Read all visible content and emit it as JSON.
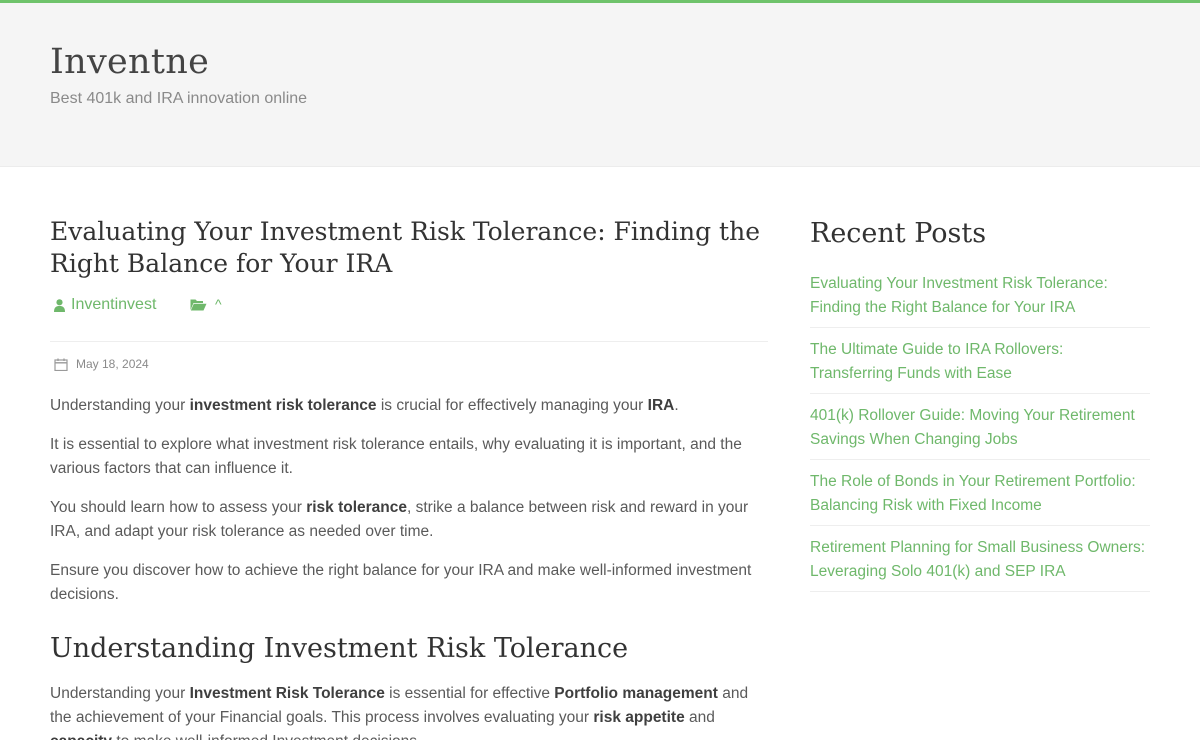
{
  "site": {
    "title": "Inventne",
    "tagline": "Best 401k and IRA innovation online"
  },
  "colors": {
    "accent": "#6fc36b",
    "link": "#6fb86b",
    "header_bg": "#f5f5f5",
    "text": "#555555"
  },
  "post": {
    "title": "Evaluating Your Investment Risk Tolerance: Finding the Right Balance for Your IRA",
    "author": "Inventinvest",
    "category": "^",
    "date": "May 18, 2024",
    "author_icon": "user-icon",
    "category_icon": "folder-open-icon",
    "date_icon": "calendar-icon",
    "paragraphs": [
      [
        {
          "t": "Understanding your "
        },
        {
          "t": "investment risk tolerance",
          "b": true
        },
        {
          "t": " is crucial for effectively managing your "
        },
        {
          "t": "IRA",
          "b": true
        },
        {
          "t": "."
        }
      ],
      [
        {
          "t": "It is essential to explore what investment risk tolerance entails, why evaluating it is important, and the various factors that can influence it."
        }
      ],
      [
        {
          "t": "You should learn how to assess your "
        },
        {
          "t": "risk tolerance",
          "b": true
        },
        {
          "t": ", strike a balance between risk and reward in your IRA, and adapt your risk tolerance as needed over time."
        }
      ],
      [
        {
          "t": "Ensure you discover how to achieve the right balance for your IRA and make well-informed investment decisions."
        }
      ]
    ],
    "section": {
      "heading": "Understanding Investment Risk Tolerance",
      "paragraph": [
        {
          "t": "Understanding your "
        },
        {
          "t": "Investment Risk Tolerance",
          "b": true
        },
        {
          "t": " is essential for effective "
        },
        {
          "t": "Portfolio management",
          "b": true
        },
        {
          "t": " and the achievement of your Financial goals. This process involves evaluating your "
        },
        {
          "t": "risk appetite",
          "b": true
        },
        {
          "t": " and "
        },
        {
          "t": "capacity",
          "b": true
        },
        {
          "t": " to make well-informed Investment decisions."
        }
      ]
    }
  },
  "sidebar": {
    "widget_title": "Recent Posts",
    "recent_posts": [
      "Evaluating Your Investment Risk Tolerance: Finding the Right Balance for Your IRA",
      "The Ultimate Guide to IRA Rollovers: Transferring Funds with Ease",
      "401(k) Rollover Guide: Moving Your Retirement Savings When Changing Jobs",
      "The Role of Bonds in Your Retirement Portfolio: Balancing Risk with Fixed Income",
      "Retirement Planning for Small Business Owners: Leveraging Solo 401(k) and SEP IRA"
    ]
  }
}
